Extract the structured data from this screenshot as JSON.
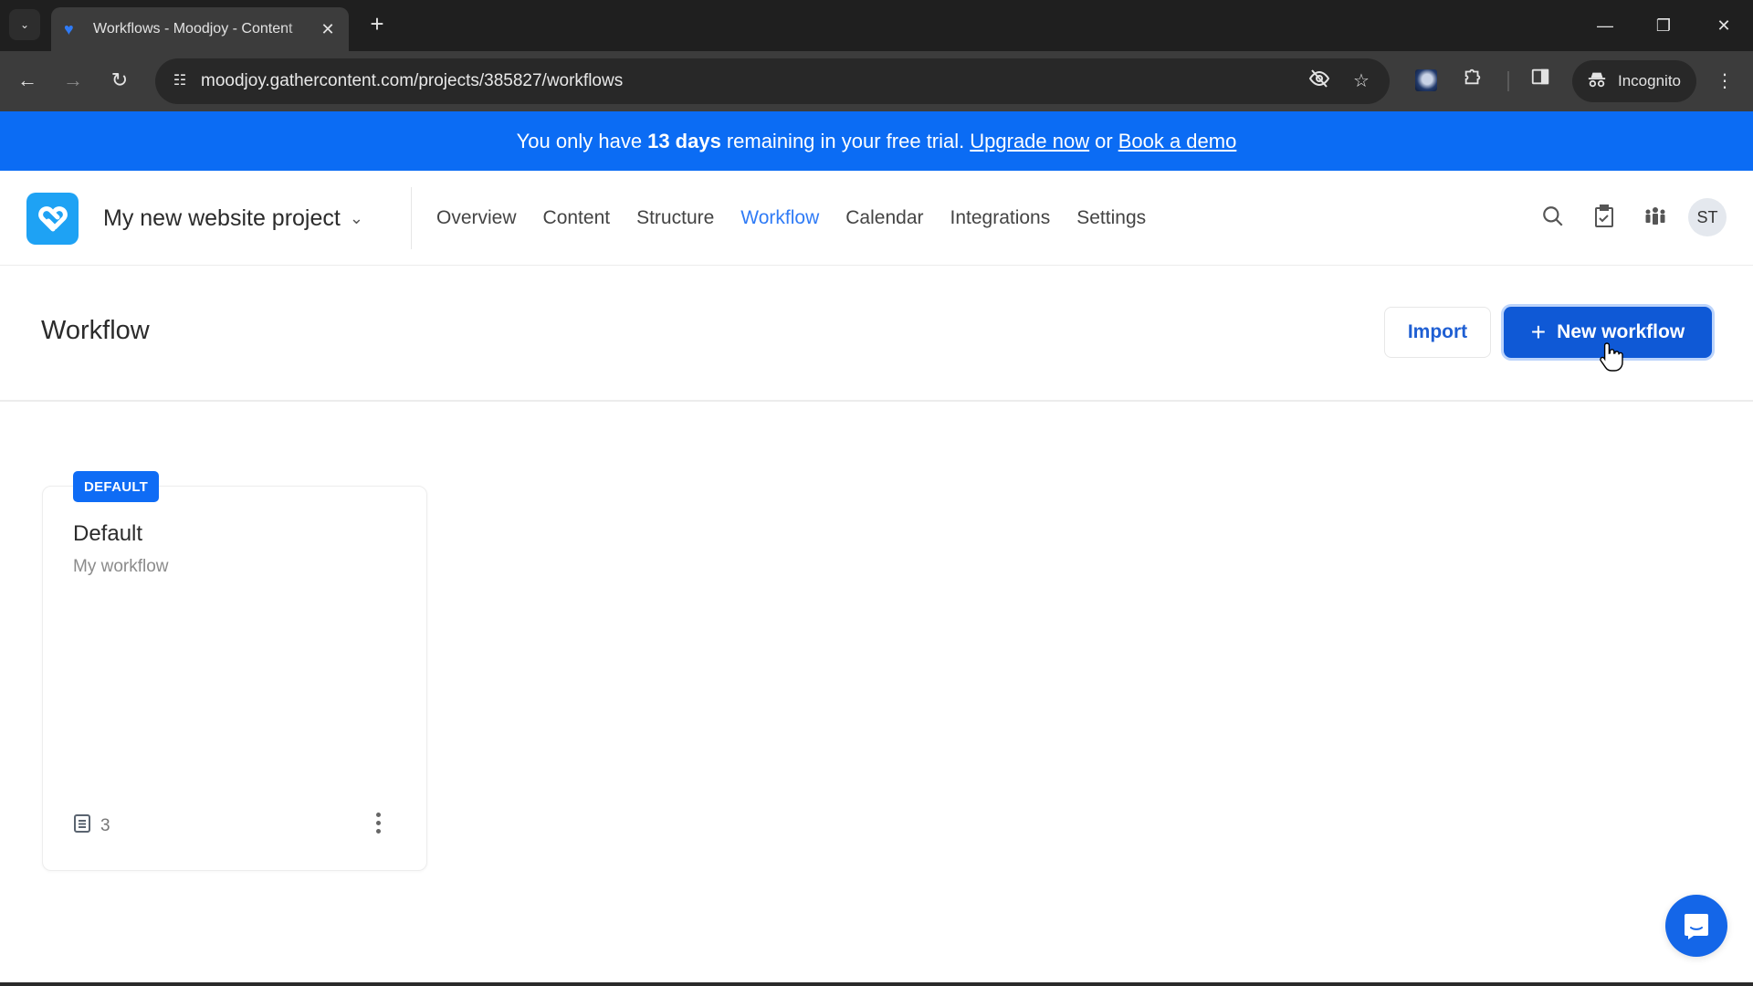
{
  "browser": {
    "tab_title": "Workflows - Moodjoy - Content",
    "url": "moodjoy.gathercontent.com/projects/385827/workflows",
    "incognito_label": "Incognito"
  },
  "banner": {
    "prefix": "You only have",
    "days": "13 days",
    "middle": "remaining in your free trial.",
    "upgrade_link": "Upgrade now",
    "or": "or",
    "demo_link": "Book a demo",
    "color": "#0b6cf4"
  },
  "header": {
    "project_name": "My new website project",
    "nav": [
      {
        "label": "Overview",
        "active": false
      },
      {
        "label": "Content",
        "active": false
      },
      {
        "label": "Structure",
        "active": false
      },
      {
        "label": "Workflow",
        "active": true
      },
      {
        "label": "Calendar",
        "active": false
      },
      {
        "label": "Integrations",
        "active": false
      },
      {
        "label": "Settings",
        "active": false
      }
    ],
    "icons": [
      "search-icon",
      "tasks-icon",
      "team-icon"
    ],
    "avatar_initials": "ST",
    "accent_color": "#2f7bf6"
  },
  "page": {
    "title": "Workflow",
    "import_label": "Import",
    "new_workflow_label": "New workflow"
  },
  "workflows": [
    {
      "badge": "DEFAULT",
      "name": "Default",
      "description": "My workflow",
      "item_count": "3"
    }
  ]
}
